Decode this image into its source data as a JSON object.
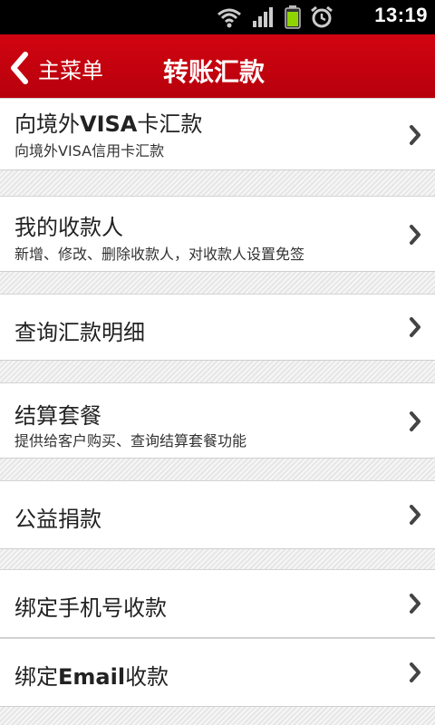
{
  "status": {
    "time": "13:19",
    "icons": [
      "wifi-icon",
      "signal-icon",
      "battery-icon",
      "alarm-icon"
    ]
  },
  "header": {
    "back_label": "主菜单",
    "title": "转账汇款"
  },
  "colors": {
    "accent": "#c8000f"
  },
  "items": [
    {
      "label_pre": "向境外",
      "label_bold": "VISA",
      "label_post": "卡汇款",
      "sub": "向境外VISA信用卡汇款"
    },
    {
      "label": "我的收款人",
      "sub": "新增、修改、删除收款人，对收款人设置免签"
    },
    {
      "label": "查询汇款明细"
    },
    {
      "label": "结算套餐",
      "sub": "提供给客户购买、查询结算套餐功能"
    },
    {
      "label": "公益捐款"
    },
    {
      "label": "绑定手机号收款"
    },
    {
      "label_pre": "绑定",
      "label_bold": "Email",
      "label_post": "收款"
    }
  ]
}
